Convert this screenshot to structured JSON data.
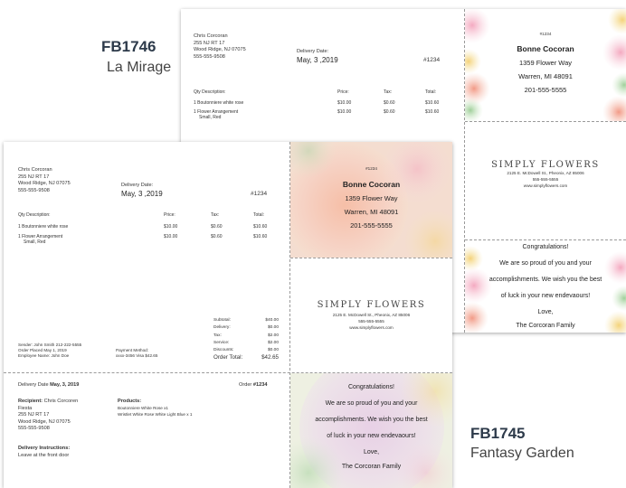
{
  "codes": {
    "fb1746": {
      "code": "FB1746",
      "name": "La Mirage"
    },
    "fb1745": {
      "code": "FB1745",
      "name": "Fantasy Garden"
    }
  },
  "card": {
    "sender": {
      "name": "Chris Corcoran",
      "street": "255 NJ RT 17",
      "city": "Wood Ridge, NJ 07075",
      "phone": "555-555-9508"
    },
    "delivery_label": "Delivery Date:",
    "delivery_date": "May, 3 ,2019",
    "order_no": "#1234",
    "cols": {
      "desc": "Qty Description:",
      "price": "Price:",
      "tax": "Tax:",
      "total": "Total:"
    },
    "items": [
      {
        "desc": "1 Boutonniere white rose",
        "desc2": "",
        "price": "$10.00",
        "tax": "$0.60",
        "total": "$10.60"
      },
      {
        "desc": "1 Flower Arrangement",
        "desc2": "Small, Red",
        "price": "$10.00",
        "tax": "$0.60",
        "total": "$10.60"
      }
    ],
    "totals": {
      "subtotal_label": "Subtotal:",
      "subtotal": "$40.00",
      "delivery_label": "Delivery:",
      "delivery": "$0.00",
      "tax_label": "Tax:",
      "tax": "$2.00",
      "service_label": "Service:",
      "service": "$2.00",
      "discounts_label": "Discounts:",
      "discounts": "$0.00",
      "order_total_label": "Order Total:",
      "order_total": "$42.65"
    },
    "sender_info": {
      "line1": "Sender: John Smith 212-222-5555",
      "line2": "Order Placed May 1, 2019",
      "line3": "Employee Name: John Doe"
    },
    "payment": {
      "label": "Payment Method:",
      "value": "xxxx-3456 Visa $42.65"
    },
    "recipient_code": "#1234",
    "recipient": {
      "name": "Bonne Cocoran",
      "street": "1359 Flower Way",
      "city": "Warren, MI 48091",
      "phone": "201-555-5555"
    },
    "shop": {
      "name": "SIMPLY FLOWERS",
      "address": "2125 E. McDowell St., Pheonix, AZ 85006",
      "phone": "555-555-5555",
      "web": "www.simplyflowers.com"
    },
    "message": {
      "line1": "Congratulations!",
      "line2": "We are so proud of you and your",
      "line3": "accomplishments. We wish you the best",
      "line4": "of luck in your new endevaours!",
      "line5": "Love,",
      "line6": "The Corcoran Family"
    },
    "stub": {
      "delivery_date_label": "Delivery Date",
      "delivery_date": "May, 3, 2019",
      "order_label": "Order",
      "order_no": "#1234",
      "recipient_label": "Recipient:",
      "recipient_name": "Chris Corcoren",
      "recipient_name2": "Fiesta",
      "street": "255 NJ RT 17",
      "city": "Wood Ridge, NJ 07075",
      "phone": "555-555-9508",
      "products_label": "Products:",
      "product1": "Boutonniere White Rose x1",
      "product2": "Wristlet White Rose White Light Blue x 1",
      "instructions_label": "Delivery Instructions:",
      "instructions": "Leave at the front door"
    }
  },
  "colors": {
    "code": "#2d3a4a",
    "dash": "#9a9a9a",
    "text": "#333333"
  }
}
